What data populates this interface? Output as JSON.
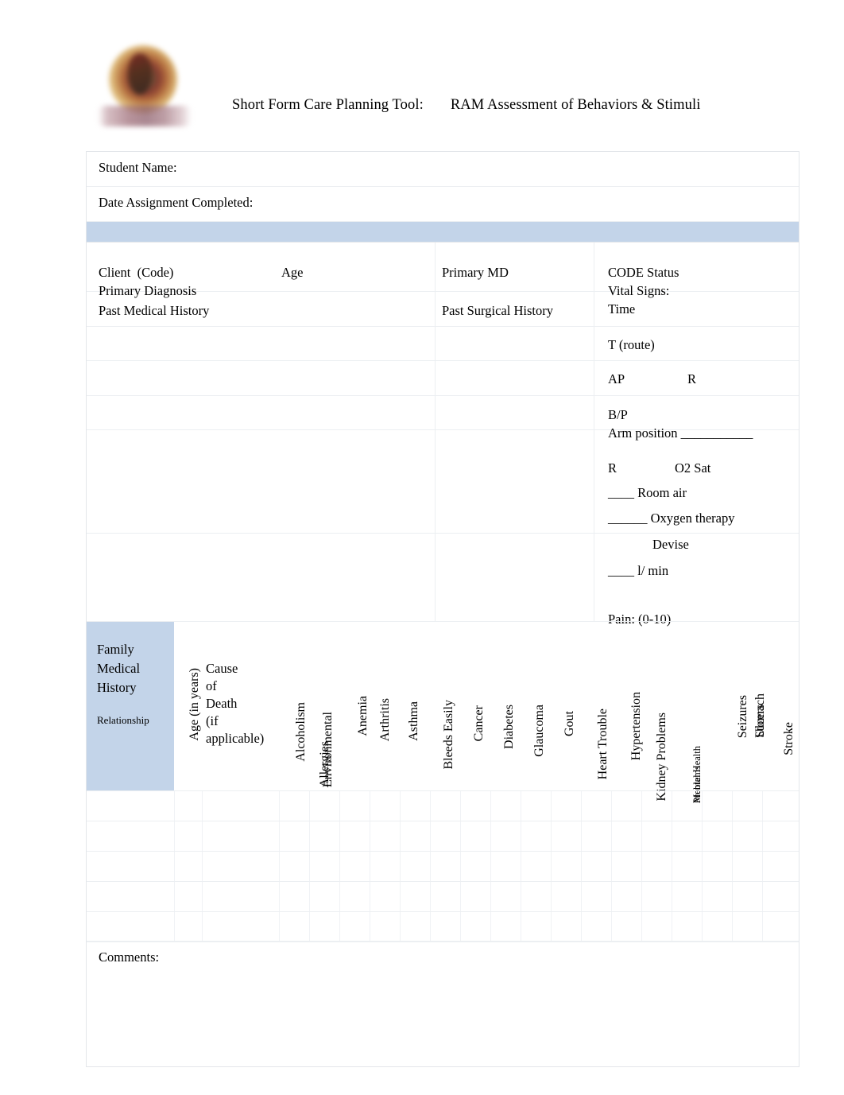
{
  "document": {
    "title_part1": "Short Form Care Planning Tool:",
    "title_part2": "RAM Assessment of Behaviors & Stimuli",
    "logo_alt": "university-seal-logo"
  },
  "identification": {
    "student_name_label": "Student Name:",
    "date_completed_label": "Date Assignment Completed:"
  },
  "clinical": {
    "client_code_label": "Client  (Code)",
    "age_label": "Age",
    "primary_diagnosis_label": "Primary Diagnosis",
    "past_medical_history_label": "Past Medical History",
    "primary_md_label": "Primary MD",
    "past_surgical_history_label": "Past Surgical History",
    "code_status_label": "CODE Status",
    "vital_signs_label": "Vital Signs:",
    "time_label": "Time",
    "temperature_label": "T (route)",
    "apical_pulse_label": "AP",
    "radial_pulse_label": "R",
    "blood_pressure_label": "B/P",
    "arm_position_label": "Arm position ___________",
    "respirations_label": "R",
    "o2_sat_label": "O2 Sat",
    "room_air_label": "____ Room air",
    "oxygen_therapy_label": "______ Oxygen therapy",
    "devise_label": "Devise",
    "liters_per_min_label": "____ l/ min",
    "pain_label": "Pain:",
    "pain_scale_label": "(0-10)"
  },
  "family_history": {
    "section_title": "Family\nMedical\nHistory",
    "relationship_label": "Relationship",
    "age_column_label": "Age (in years)",
    "cause_of_death_label": "Cause\nof\nDeath\n(if\napplicable)",
    "conditions": [
      "Alcoholism",
      "Allergies",
      "Environmental",
      "Anemia",
      "Arthritis",
      "Asthma",
      "Bleeds Easily",
      "Cancer",
      "Diabetes",
      "Glaucoma",
      "Gout",
      "Heart Trouble",
      "Hypertension",
      "Kidney Problems",
      "Mental Health",
      "Problems",
      "Seizures",
      "Stomach",
      "Ulcers",
      "Stroke"
    ],
    "row_count": 5
  },
  "comments": {
    "label": "Comments:"
  },
  "colors": {
    "band_blue": "#c3d4e9",
    "grid_line": "#eceff2",
    "text": "#000000",
    "page_background": "#ffffff"
  }
}
